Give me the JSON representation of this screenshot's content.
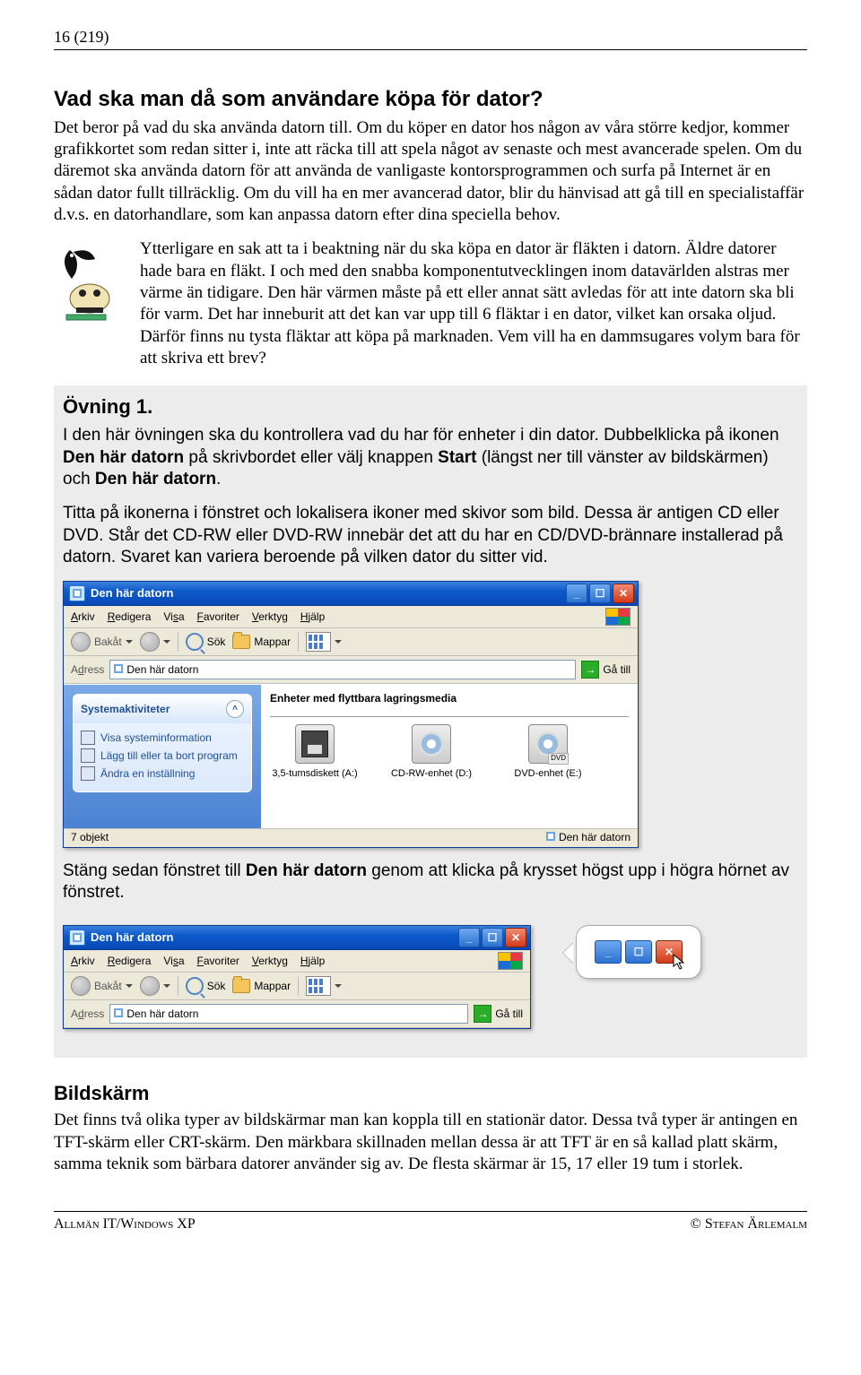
{
  "page": {
    "header": "16 (219)"
  },
  "heading1": "Vad ska man då som användare köpa för dator?",
  "para1": "Det beror på vad du ska använda datorn till. Om du köper en dator hos någon av våra större kedjor, kommer grafikkortet som redan sitter i, inte att räcka till att spela något av senaste och mest avancerade spelen. Om du däremot ska använda datorn för att använda de vanligaste kontorsprogrammen och surfa på Internet är en sådan dator fullt tillräcklig. Om du vill ha en mer avancerad dator, blir du hänvisad att gå till en specialistaffär d.v.s. en datorhandlare, som kan anpassa datorn efter dina speciella behov.",
  "tip": "Ytterligare en sak att ta i beaktning när du ska köpa en dator är fläkten i datorn. Äldre datorer hade bara en fläkt. I och med den snabba komponentutvecklingen inom datavärlden alstras mer värme än tidigare. Den här värmen måste på ett eller annat sätt avledas för att inte datorn ska bli för varm. Det har inneburit att det kan var upp till 6 fläktar i en dator, vilket kan orsaka oljud. Därför finns nu tysta fläktar att köpa på marknaden. Vem vill ha en dammsugares volym bara för att skriva ett brev?",
  "exercise": {
    "title": "Övning 1.",
    "p1a": "I den här övningen ska du kontrollera vad du har för enheter i din dator. Dubbelklicka på ikonen ",
    "p1b": "Den här datorn",
    "p1c": " på skrivbordet eller välj knappen ",
    "p1d": "Start",
    "p1e": " (längst ner till vänster av bildskärmen) och ",
    "p1f": "Den här datorn",
    "p1g": ".",
    "p2": "Titta på ikonerna i fönstret och lokalisera ikoner med skivor som bild. Dessa är antigen CD eller DVD. Står det CD-RW eller DVD-RW innebär det att du har en CD/DVD-brännare installerad på datorn. Svaret kan variera beroende på vilken dator du sitter vid.",
    "p3a": "Stäng sedan fönstret till ",
    "p3b": "Den här datorn",
    "p3c": " genom att klicka på krysset högst upp i högra hörnet av fönstret."
  },
  "xp": {
    "title": "Den här datorn",
    "menu": {
      "arkiv": "Arkiv",
      "redigera": "Redigera",
      "visa": "Visa",
      "favoriter": "Favoriter",
      "verktyg": "Verktyg",
      "hjalp": "Hjälp"
    },
    "toolbar": {
      "back": "Bakåt",
      "sok": "Sök",
      "mappar": "Mappar"
    },
    "address": {
      "label": "Adress",
      "value": "Den här datorn",
      "go": "Gå till"
    },
    "taskpanel": {
      "title": "Systemaktiviteter",
      "link1": "Visa systeminformation",
      "link2": "Lägg till eller ta bort program",
      "link3": "Ändra en inställning"
    },
    "groupTitle": "Enheter med flyttbara lagringsmedia",
    "drives": {
      "a": "3,5-tumsdiskett (A:)",
      "d": "CD-RW-enhet (D:)",
      "e": "DVD-enhet (E:)"
    },
    "status": {
      "left": "7 objekt",
      "right": "Den här datorn"
    }
  },
  "bildskarm": {
    "heading": "Bildskärm",
    "body": "Det finns två olika typer av bildskärmar man kan koppla till en stationär dator. Dessa två typer är antingen en TFT-skärm eller CRT-skärm. Den märkbara skillnaden mellan dessa är att TFT är en så kallad platt skärm, samma teknik som bärbara datorer använder sig av. De flesta skärmar är 15, 17 eller 19 tum i storlek."
  },
  "footer": {
    "left": "Allmän IT/Windows XP",
    "right": "© Stefan Ärlemalm"
  }
}
